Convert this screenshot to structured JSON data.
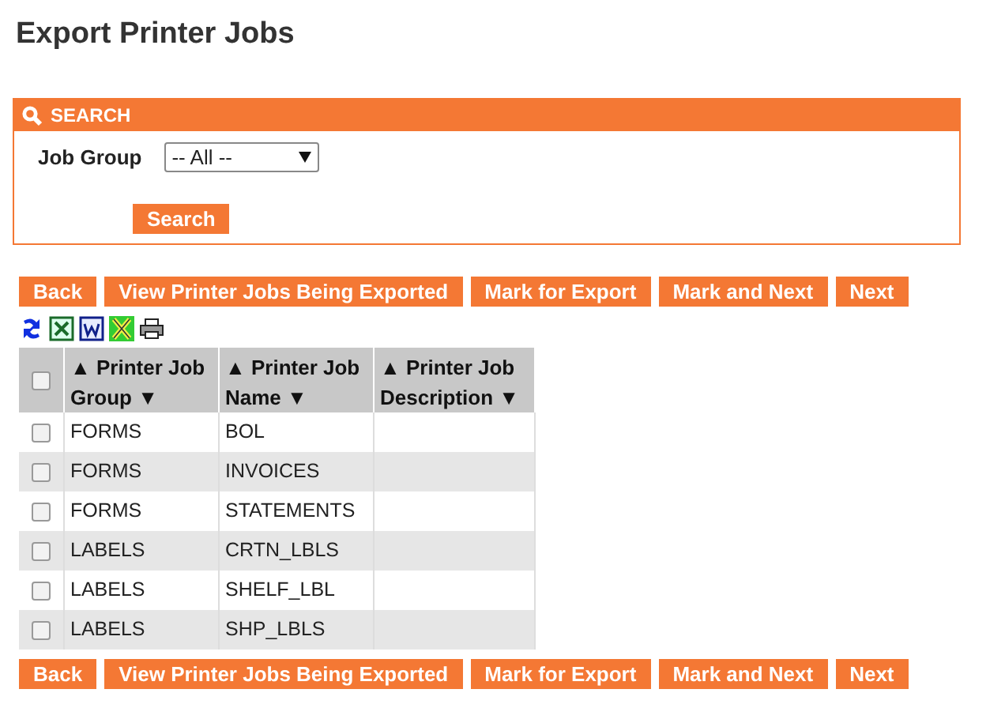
{
  "page": {
    "title": "Export Printer Jobs"
  },
  "search": {
    "title": "SEARCH",
    "fields": [
      {
        "label": "Job Group",
        "value": "-- All --"
      }
    ],
    "button": "Search"
  },
  "top_buttons": [
    "Back",
    "View Printer Jobs Being Exported",
    "Mark for Export",
    "Mark and Next",
    "Next"
  ],
  "table": {
    "select_all": {
      "checked": false
    },
    "columns": [
      {
        "label": "▲ Printer Job Group ▼"
      },
      {
        "label": "▲ Printer Job Name ▼"
      },
      {
        "label": "▲ Printer Job Description ▼"
      }
    ],
    "rows": [
      {
        "checked": false,
        "cells": [
          "FORMS",
          "BOL",
          ""
        ]
      },
      {
        "checked": false,
        "cells": [
          "FORMS",
          "INVOICES",
          ""
        ]
      },
      {
        "checked": false,
        "cells": [
          "FORMS",
          "STATEMENTS",
          ""
        ]
      },
      {
        "checked": false,
        "cells": [
          "LABELS",
          "CRTN_LBLS",
          ""
        ]
      },
      {
        "checked": false,
        "cells": [
          "LABELS",
          "SHELF_LBL",
          ""
        ]
      },
      {
        "checked": false,
        "cells": [
          "LABELS",
          "SHP_LBLS",
          ""
        ]
      }
    ]
  },
  "bottom_buttons": [
    "Back",
    "View Printer Jobs Being Exported",
    "Mark for Export",
    "Mark and Next",
    "Next"
  ]
}
